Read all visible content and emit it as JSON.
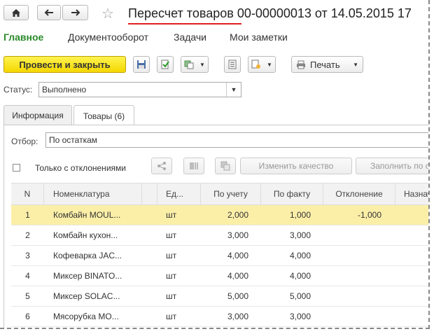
{
  "window": {
    "title": "Пересчет товаров 00-00000013 от 14.05.2015 17"
  },
  "menu": {
    "items": [
      "Главное",
      "Документооборот",
      "Задачи",
      "Мои заметки"
    ]
  },
  "toolbar": {
    "post_close": "Провести и закрыть",
    "print": "Печать"
  },
  "status": {
    "label": "Статус:",
    "value": "Выполнено"
  },
  "tabs": [
    {
      "label": "Информация"
    },
    {
      "label": "Товары (6)"
    }
  ],
  "goods": {
    "filter_label": "Отбор:",
    "filter_value": "По остаткам",
    "only_deviations": "Только с отклонениями",
    "change_quality": "Изменить качество",
    "fill_by": "Заполнить по о",
    "columns": [
      "N",
      "Номенклатура",
      "Ед...",
      "По учету",
      "По факту",
      "Отклонение",
      "Назнач"
    ],
    "rows": [
      {
        "n": "1",
        "name": "Комбайн MOUL...",
        "unit": "шт",
        "acc": "2,000",
        "fact": "1,000",
        "dev": "-1,000"
      },
      {
        "n": "2",
        "name": "Комбайн кухон...",
        "unit": "шт",
        "acc": "3,000",
        "fact": "3,000",
        "dev": ""
      },
      {
        "n": "3",
        "name": "Кофеварка JAC...",
        "unit": "шт",
        "acc": "4,000",
        "fact": "4,000",
        "dev": ""
      },
      {
        "n": "4",
        "name": "Миксер BINATO...",
        "unit": "шт",
        "acc": "4,000",
        "fact": "4,000",
        "dev": ""
      },
      {
        "n": "5",
        "name": "Миксер SOLAC...",
        "unit": "шт",
        "acc": "5,000",
        "fact": "5,000",
        "dev": ""
      },
      {
        "n": "6",
        "name": "Мясорубка МО...",
        "unit": "шт",
        "acc": "3,000",
        "fact": "3,000",
        "dev": ""
      }
    ]
  }
}
